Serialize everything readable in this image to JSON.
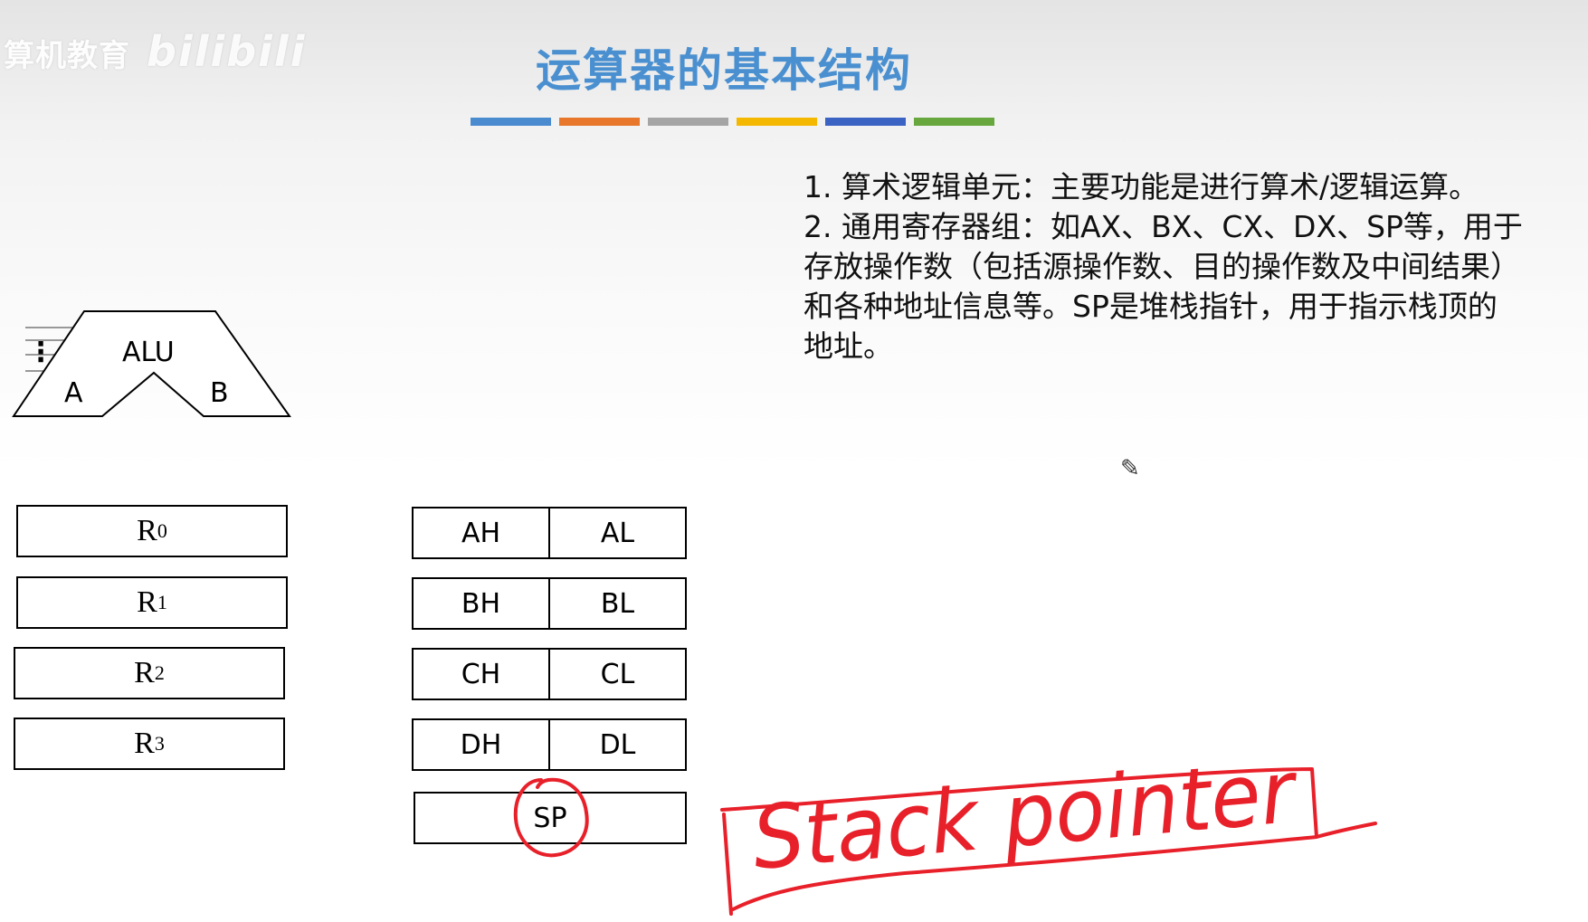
{
  "watermark": {
    "text": "算机教育",
    "ghost": "bilibili"
  },
  "title": {
    "text": "运算器的基本结构",
    "color": "#4a90d0"
  },
  "title_bar_colors": [
    "#4a8bd0",
    "#e8762b",
    "#a5a5a5",
    "#f5b800",
    "#3b63c4",
    "#67a73e"
  ],
  "description": {
    "line1": "1. 算术逻辑单元：主要功能是进行算术/逻辑运算。",
    "line2": "2. 通用寄存器组：如AX、BX、CX、DX、SP等，用于",
    "line3": "存放操作数（包括源操作数、目的操作数及中间结果）",
    "line4": "和各种地址信息等。SP是堆栈指针，用于指示栈顶的",
    "line5": "地址。"
  },
  "alu": {
    "label": "ALU",
    "input_a": "A",
    "input_b": "B",
    "dots": "⋮"
  },
  "registers_r": [
    {
      "base": "R",
      "sub": "0"
    },
    {
      "base": "R",
      "sub": "1"
    },
    {
      "base": "R",
      "sub": "2"
    },
    {
      "base": "R",
      "sub": "3"
    }
  ],
  "registers_x": [
    {
      "high": "AH",
      "low": "AL"
    },
    {
      "high": "BH",
      "low": "BL"
    },
    {
      "high": "CH",
      "low": "CL"
    },
    {
      "high": "DH",
      "low": "DL"
    }
  ],
  "stack_pointer": {
    "label": "SP"
  },
  "annotation": {
    "handwritten_text": "Stack pointer",
    "ink_color": "#e8202a"
  }
}
